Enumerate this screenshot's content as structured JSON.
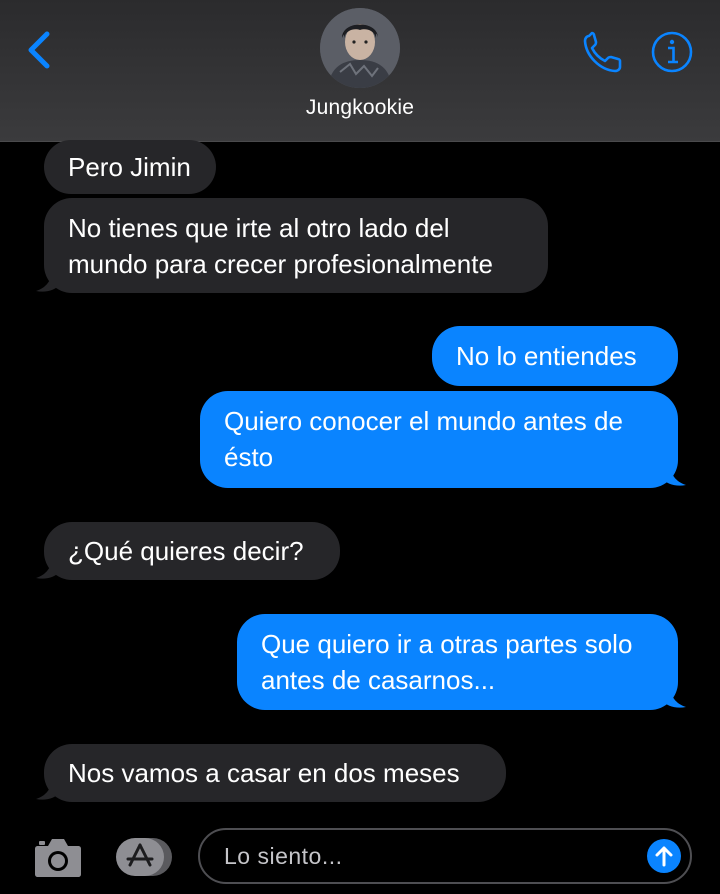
{
  "header": {
    "contact_name": "Jungkookie",
    "back_icon": "chevron-left-icon",
    "call_icon": "phone-icon",
    "info_icon": "info-icon"
  },
  "messages": [
    {
      "direction": "incoming",
      "lines": [
        "Pero Jimin"
      ]
    },
    {
      "direction": "incoming",
      "lines": [
        "No tienes que irte al otro lado del",
        "mundo para crecer profesionalmente"
      ]
    },
    {
      "direction": "outgoing",
      "lines": [
        "No lo entiendes"
      ]
    },
    {
      "direction": "outgoing",
      "lines": [
        "Quiero conocer el mundo antes de",
        "ésto"
      ]
    },
    {
      "direction": "incoming",
      "lines": [
        "¿Qué quieres decir?"
      ]
    },
    {
      "direction": "outgoing",
      "lines": [
        "Que quiero ir a otras partes solo",
        "antes de casarnos..."
      ]
    },
    {
      "direction": "incoming",
      "lines": [
        "Nos vamos a casar en dos meses"
      ]
    }
  ],
  "composer": {
    "input_value": "Lo siento...",
    "camera_icon": "camera-icon",
    "apps_icon": "app-store-icon",
    "send_icon": "send-arrow-up-icon"
  },
  "colors": {
    "outgoing_bubble": "#0a84ff",
    "incoming_bubble": "#262629",
    "accent": "#0a84ff",
    "background": "#000000"
  }
}
